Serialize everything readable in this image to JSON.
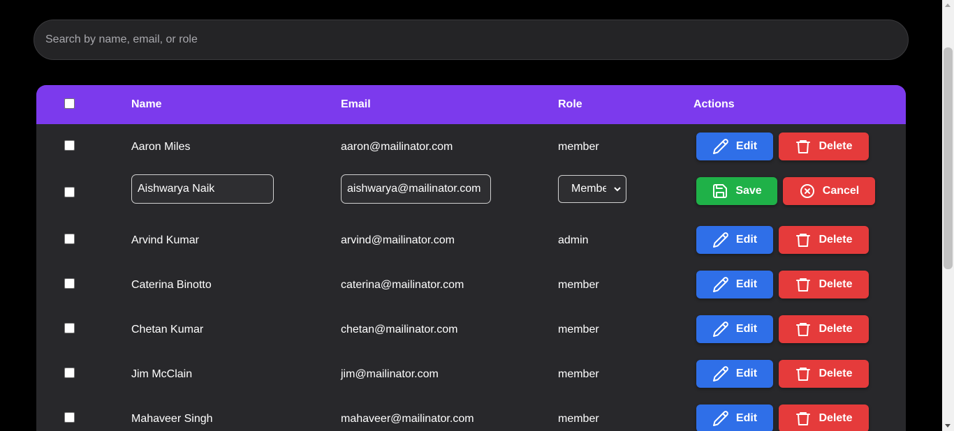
{
  "search": {
    "placeholder": "Search by name, email, or role",
    "value": ""
  },
  "table": {
    "headers": {
      "name": "Name",
      "email": "Email",
      "role": "Role",
      "actions": "Actions"
    },
    "header_color": "#7c3aed",
    "rows": [
      {
        "name": "Aaron Miles",
        "email": "aaron@mailinator.com",
        "role": "member"
      },
      {
        "name": "Aishwarya Naik",
        "email": "aishwarya@mailinator.com",
        "role": "Member",
        "editing": true
      },
      {
        "name": "Arvind Kumar",
        "email": "arvind@mailinator.com",
        "role": "admin"
      },
      {
        "name": "Caterina Binotto",
        "email": "caterina@mailinator.com",
        "role": "member"
      },
      {
        "name": "Chetan Kumar",
        "email": "chetan@mailinator.com",
        "role": "member"
      },
      {
        "name": "Jim McClain",
        "email": "jim@mailinator.com",
        "role": "member"
      },
      {
        "name": "Mahaveer Singh",
        "email": "mahaveer@mailinator.com",
        "role": "member"
      }
    ]
  },
  "actions": {
    "edit_label": "Edit",
    "delete_label": "Delete",
    "save_label": "Save",
    "cancel_label": "Cancel",
    "edit_color": "#2f6fe8",
    "delete_color": "#e53b3b",
    "save_color": "#1fb148"
  },
  "icons": {
    "edit": "pencil-icon",
    "delete": "trash-icon",
    "save": "floppy-disk-icon",
    "cancel": "x-circle-icon",
    "select": "chevron-down-icon"
  }
}
